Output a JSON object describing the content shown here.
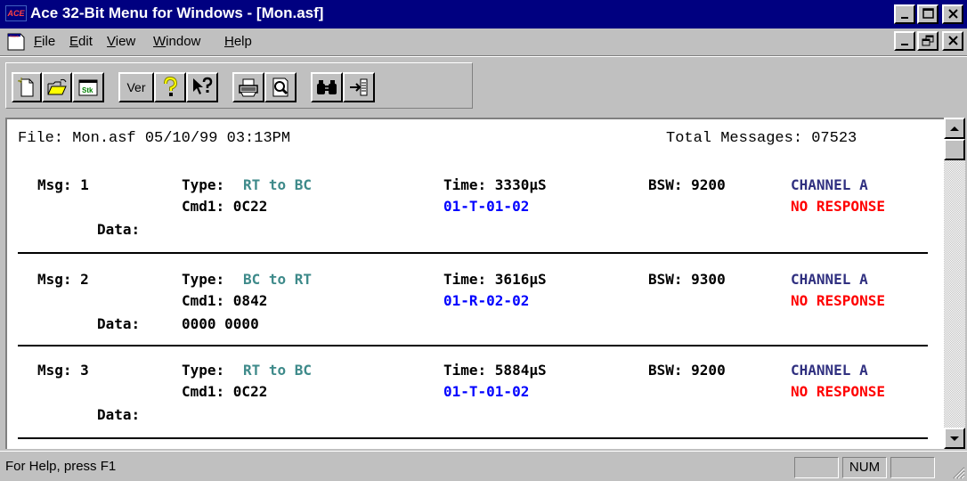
{
  "window": {
    "app_icon_text": "ACE",
    "title": "Ace 32-Bit Menu for Windows - [Mon.asf]"
  },
  "menu": {
    "items": [
      "File",
      "Edit",
      "View",
      "Window",
      "Help"
    ]
  },
  "toolbar": {
    "buttons": [
      {
        "name": "new-icon"
      },
      {
        "name": "open-folder-icon"
      },
      {
        "name": "stack-icon",
        "label": "Stk"
      },
      {
        "name": "version-button",
        "label": "Ver"
      },
      {
        "name": "help-question-icon"
      },
      {
        "name": "context-help-icon"
      },
      {
        "name": "print-icon"
      },
      {
        "name": "print-preview-icon"
      },
      {
        "name": "find-binoculars-icon"
      },
      {
        "name": "go-to-icon"
      }
    ]
  },
  "document": {
    "file_line": "File: Mon.asf 05/10/99 03:13PM",
    "total_messages": "Total Messages: 07523",
    "messages": [
      {
        "msg": "Msg: 1",
        "type_label": "Type:",
        "type_value": "RT to BC",
        "time": "Time: 3330µS",
        "bsw": "BSW: 9200",
        "channel": "CHANNEL A",
        "cmd": "Cmd1: 0C22",
        "cmd_decode": "01-T-01-02",
        "status": "NO RESPONSE",
        "data_label": "Data:",
        "data": ""
      },
      {
        "msg": "Msg: 2",
        "type_label": "Type:",
        "type_value": "BC to RT",
        "time": "Time: 3616µS",
        "bsw": "BSW: 9300",
        "channel": "CHANNEL A",
        "cmd": "Cmd1: 0842",
        "cmd_decode": "01-R-02-02",
        "status": "NO RESPONSE",
        "data_label": "Data:",
        "data": "0000 0000"
      },
      {
        "msg": "Msg: 3",
        "type_label": "Type:",
        "type_value": "RT to BC",
        "time": "Time: 5884µS",
        "bsw": "BSW: 9200",
        "channel": "CHANNEL A",
        "cmd": "Cmd1: 0C22",
        "cmd_decode": "01-T-01-02",
        "status": "NO RESPONSE",
        "data_label": "Data:",
        "data": ""
      }
    ]
  },
  "statusbar": {
    "help_text": "For Help, press F1",
    "num_indicator": "NUM"
  },
  "colors": {
    "title_bar": "#000080",
    "type_value": "#3e8a8a",
    "cmd_decode": "#0000ff",
    "channel": "#303080",
    "no_response": "#ff0000"
  }
}
